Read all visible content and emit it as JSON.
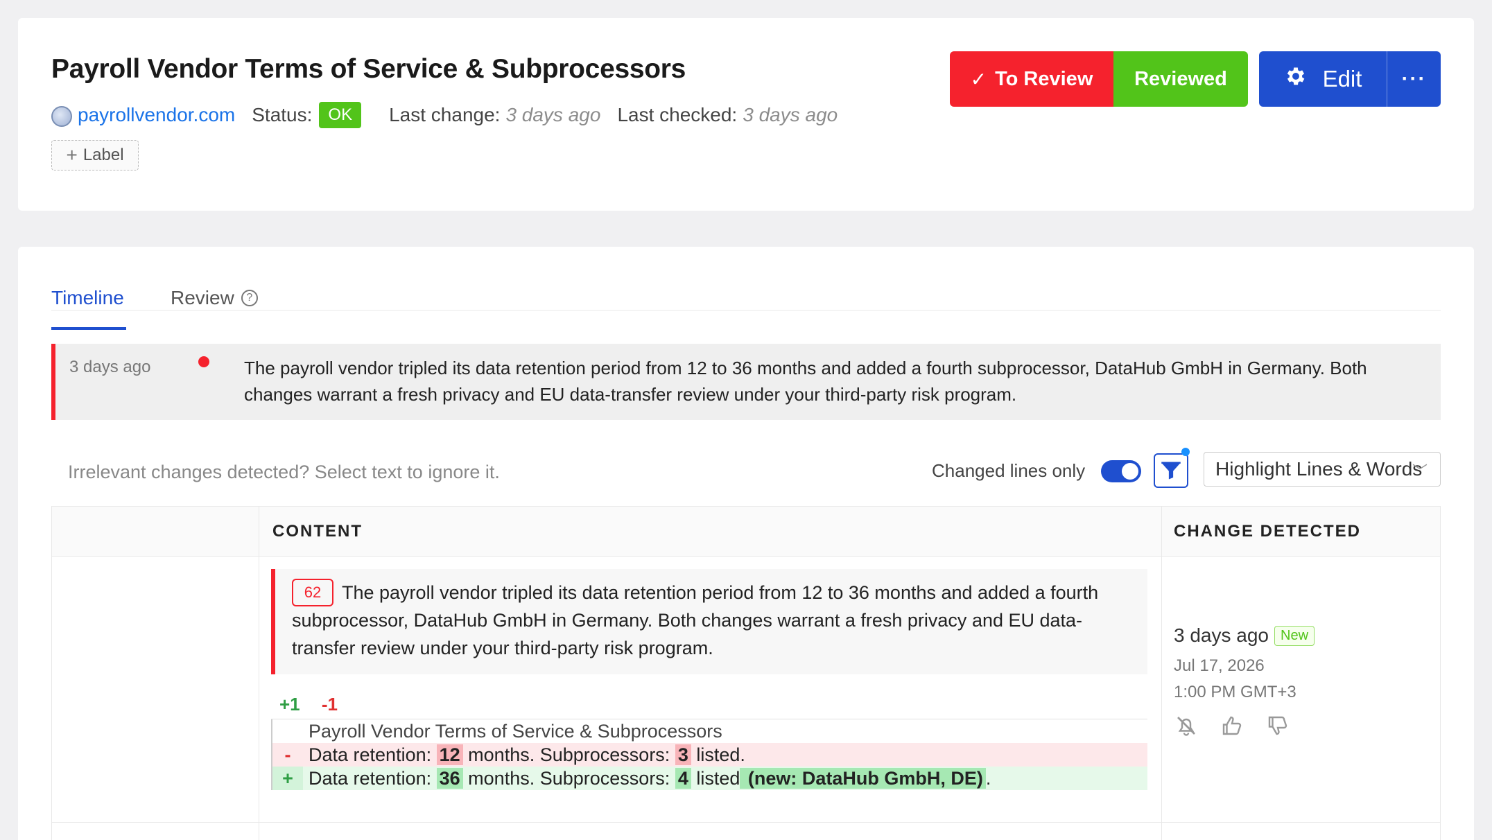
{
  "header": {
    "title": "Payroll Vendor Terms of Service & Subprocessors",
    "site_link": "payrollvendor.com",
    "status_label": "Status:",
    "status_value": "OK",
    "last_change_label": "Last change:",
    "last_change_value": "3 days ago",
    "last_checked_label": "Last checked:",
    "last_checked_value": "3 days ago",
    "label_button": "Label"
  },
  "actions": {
    "to_review": "To Review",
    "reviewed": "Reviewed",
    "edit": "Edit",
    "more": "···"
  },
  "tabs": {
    "timeline": "Timeline",
    "review": "Review"
  },
  "summary": {
    "time": "3 days ago",
    "text": "The payroll vendor tripled its data retention period from 12 to 36 months and added a fourth subprocessor, DataHub GmbH in Germany. Both changes warrant a fresh privacy and EU data-transfer review under your third-party risk program."
  },
  "toolbar": {
    "hint": "Irrelevant changes detected? Select text to ignore it.",
    "toggle_label": "Changed lines only",
    "select_value": "Highlight Lines & Words"
  },
  "table": {
    "col_content": "CONTENT",
    "col_change": "CHANGE DETECTED"
  },
  "change": {
    "line_number": "62",
    "text": "The payroll vendor tripled its data retention period from 12 to 36 months and added a fourth subprocessor, DataHub GmbH in Germany. Both changes warrant a fresh privacy and EU data-transfer review under your third-party risk program.",
    "plus_count": "+1",
    "minus_count": "-1",
    "context_line": "Payroll Vendor Terms of Service & Subprocessors",
    "del_gutter": "-",
    "del_a": "Data retention: ",
    "del_hl1": "12",
    "del_b": " months. Subprocessors: ",
    "del_hl2": "3",
    "del_c": " listed.",
    "add_gutter": "+",
    "add_a": "Data retention: ",
    "add_hl1": "36",
    "add_b": " months. Subprocessors: ",
    "add_hl2": "4",
    "add_c": " listed",
    "add_hl3": " (new: DataHub GmbH, DE)",
    "add_d": "."
  },
  "change_detected": {
    "relative": "3 days ago",
    "badge": "New",
    "date": "Jul 17, 2026",
    "time": "1:00 PM GMT+3"
  },
  "colors": {
    "accent": "#1f4fcf",
    "danger": "#f5222d",
    "success": "#52c41a"
  }
}
